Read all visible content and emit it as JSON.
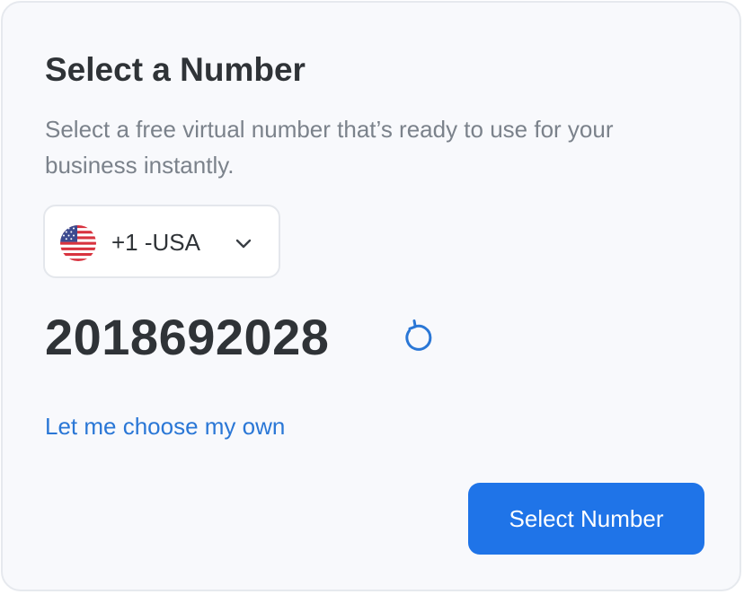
{
  "title": "Select a Number",
  "subtitle": "Select a free virtual number that’s ready to use for your business instantly.",
  "country_select": {
    "flag_icon": "us-flag-icon",
    "value": "+1 -USA",
    "chevron_icon": "chevron-down-icon"
  },
  "number": "2018692028",
  "refresh_icon": "refresh-icon",
  "choose_link": "Let me choose my own",
  "select_button": "Select Number",
  "colors": {
    "accent": "#1f74e8",
    "link": "#2a77d6",
    "text": "#2f3337",
    "muted": "#7b828b",
    "card_bg": "#f8f9fc"
  }
}
